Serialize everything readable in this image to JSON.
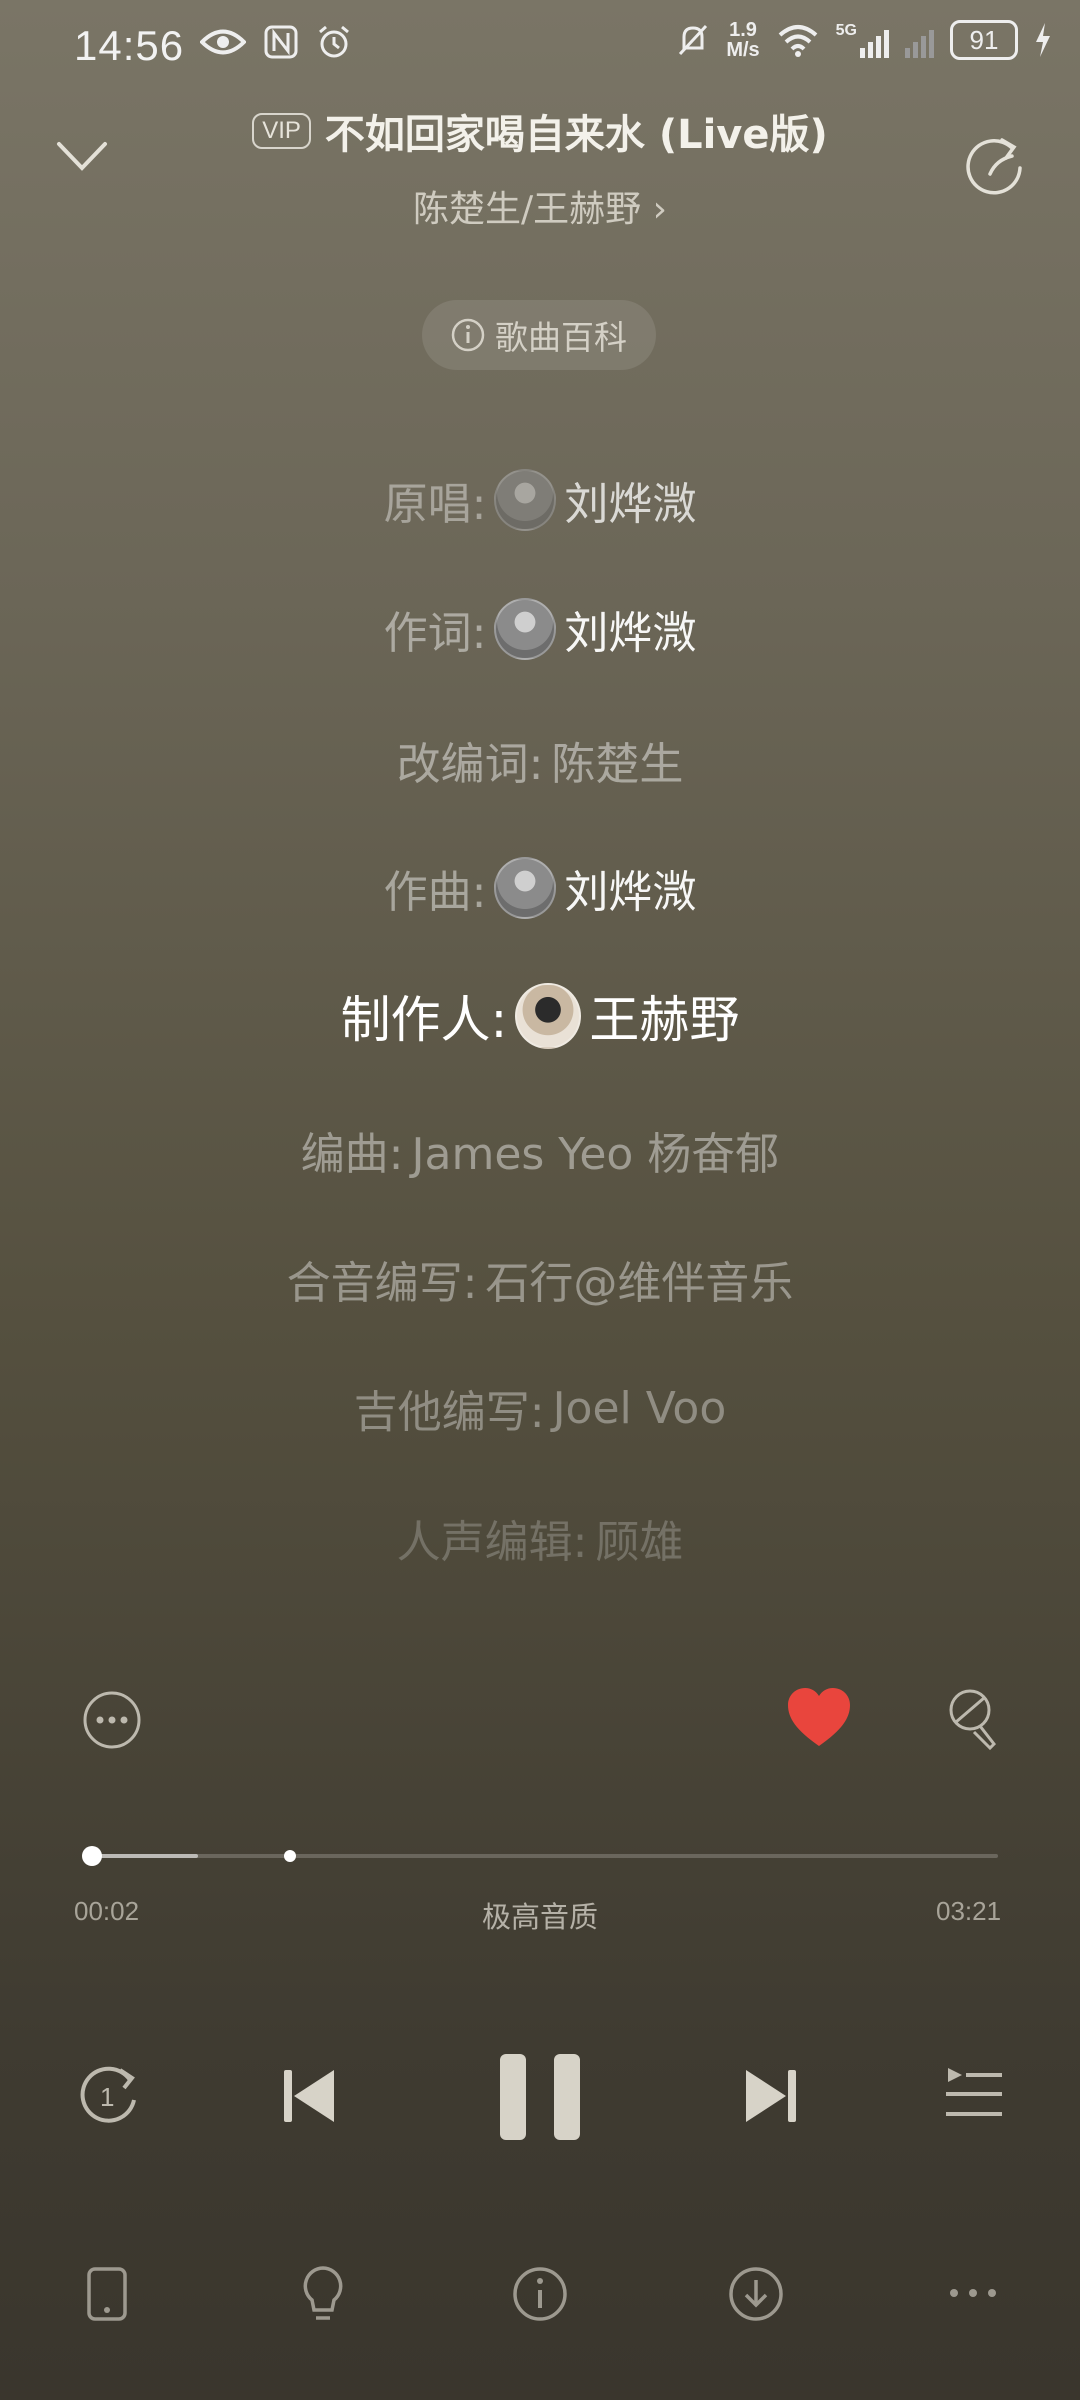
{
  "status_bar": {
    "time": "14:56",
    "net_speed_value": "1.9",
    "net_speed_unit": "M/s",
    "signal_label": "5G",
    "battery": "91"
  },
  "header": {
    "vip_badge": "VIP",
    "song_title": "不如回家喝自来水 (Live版)",
    "artists": "陈楚生/王赫野",
    "artist_chevron": "›",
    "wiki_label": "歌曲百科"
  },
  "credits": [
    {
      "label": "原唱:",
      "name": "刘烨溦"
    },
    {
      "label": "作词:",
      "name": "刘烨溦"
    },
    {
      "label": "改编词:",
      "name": "陈楚生"
    },
    {
      "label": "作曲:",
      "name": "刘烨溦"
    },
    {
      "label": "制作人:",
      "name": "王赫野"
    },
    {
      "label": "编曲:",
      "name": "James Yeo 杨奋郁"
    },
    {
      "label": "合音编写:",
      "name": "石行@维伴音乐"
    },
    {
      "label": "吉他编写:",
      "name": "Joel Voo"
    },
    {
      "label": "人声编辑:",
      "name": "顾雄"
    }
  ],
  "player": {
    "current_time": "00:02",
    "total_time": "03:21",
    "quality": "极高音质",
    "progress": 0.01,
    "liked": true
  },
  "icons": {
    "heart_color": "#e9453d"
  }
}
